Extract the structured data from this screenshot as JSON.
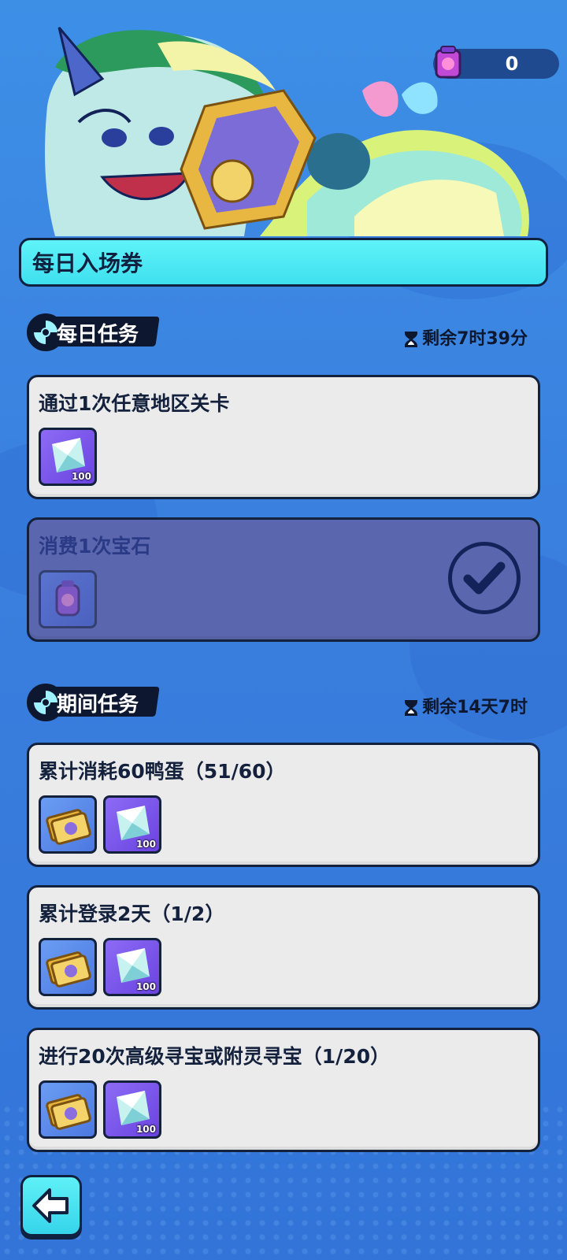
{
  "currency": {
    "icon": "lantern-ticket-icon",
    "value": "0"
  },
  "title": "每日入场券",
  "daily": {
    "label": "每日任务",
    "timer": "剩余7时39分",
    "tasks": [
      {
        "title": "通过1次任意地区关卡",
        "completed": false,
        "rewards": [
          {
            "icon": "crystal-icon",
            "qty": "100"
          }
        ]
      },
      {
        "title": "消费1次宝石",
        "completed": true,
        "rewards": [
          {
            "icon": "lantern-icon",
            "qty": ""
          }
        ]
      }
    ]
  },
  "period": {
    "label": "期间任务",
    "timer": "剩余14天7时",
    "tasks": [
      {
        "title": "累计消耗60鸭蛋（51/60）",
        "rewards": [
          {
            "icon": "gold-ticket-icon",
            "qty": ""
          },
          {
            "icon": "crystal-icon",
            "qty": "100"
          }
        ]
      },
      {
        "title": "累计登录2天（1/2）",
        "rewards": [
          {
            "icon": "gold-ticket-icon",
            "qty": ""
          },
          {
            "icon": "crystal-icon",
            "qty": "100"
          }
        ]
      },
      {
        "title": "进行20次高级寻宝或附灵寻宝（1/20）",
        "rewards": [
          {
            "icon": "gold-ticket-icon",
            "qty": ""
          },
          {
            "icon": "crystal-icon",
            "qty": "100"
          }
        ]
      }
    ]
  },
  "colors": {
    "accent": "#3fe0ef",
    "card": "#ebebeb",
    "completed_card": "#5a66ad",
    "outline": "#14213d"
  }
}
